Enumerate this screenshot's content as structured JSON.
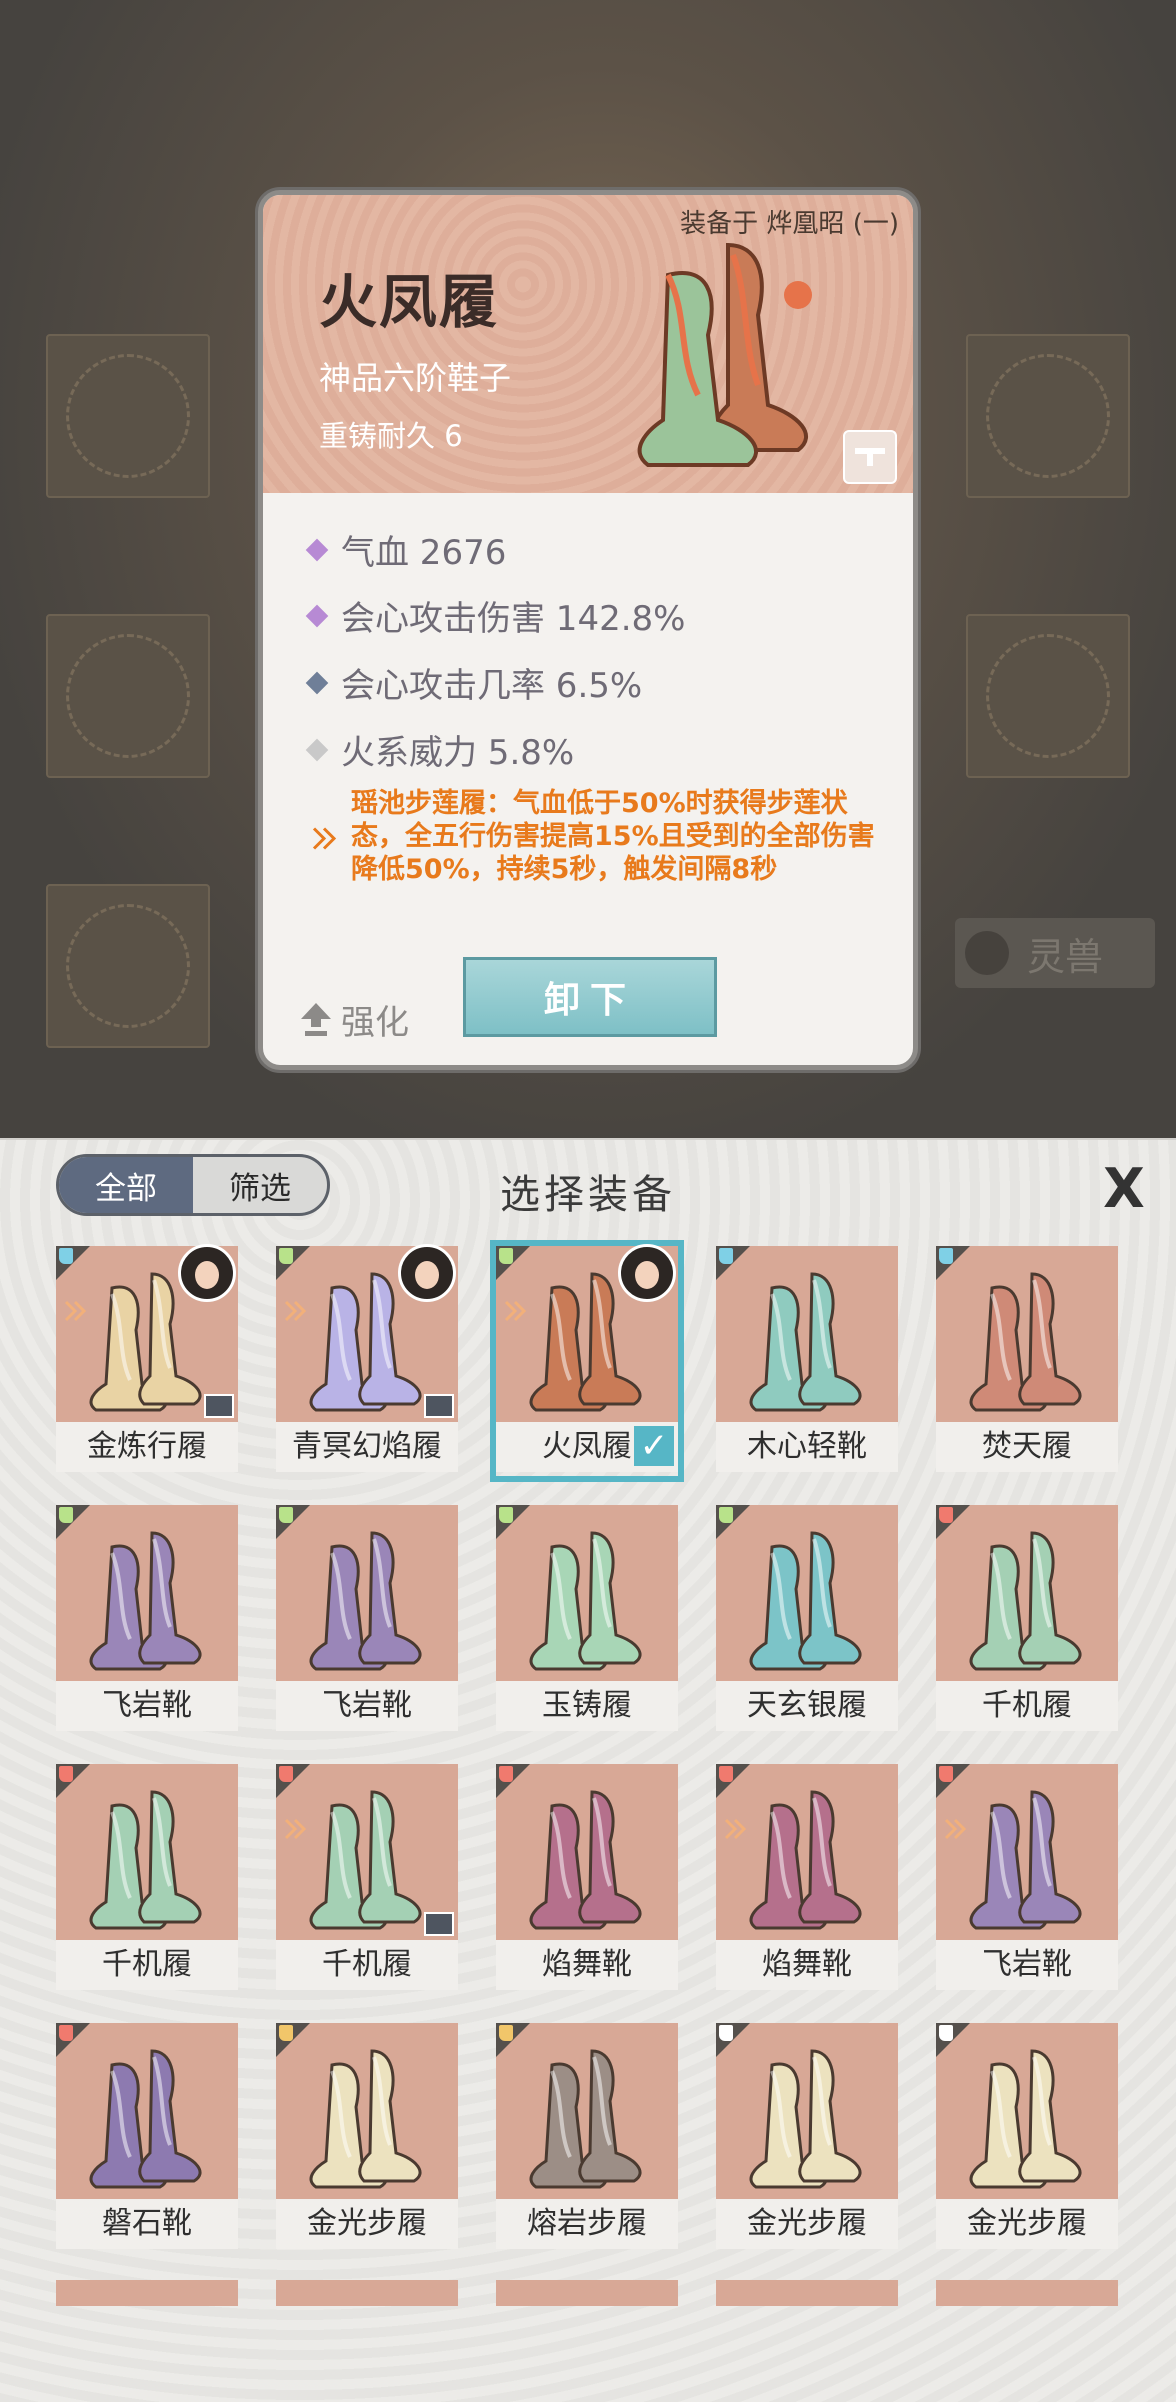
{
  "background": {
    "beast_label": "灵兽"
  },
  "detail": {
    "equipped_on": "装备于 烨凰昭 (一)",
    "name": "火凤履",
    "grade": "神品六阶鞋子",
    "durability": "重铸耐久 6",
    "stats": [
      {
        "text": "气血 2676",
        "color": "#b78ad4"
      },
      {
        "text": "会心攻击伤害 142.8%",
        "color": "#b78ad4"
      },
      {
        "text": "会心攻击几率 6.5%",
        "color": "#6f7f98"
      },
      {
        "text": "火系威力 5.8%",
        "color": "#c9c9c9"
      }
    ],
    "effect": "瑶池步莲履：气血低于50%时获得步莲状态，全五行伤害提高15%且受到的全部伤害降低50%，持续5秒，触发间隔8秒",
    "upgrade_label": "强化",
    "unequip_label": "卸下"
  },
  "panel": {
    "title": "选择装备",
    "tab_all": "全部",
    "tab_filter": "筛选",
    "close": "X"
  },
  "items": [
    {
      "name": "金炼行履",
      "tier": "blue",
      "color": "#e9d3a4",
      "bound": true,
      "tag": true,
      "avatar": true
    },
    {
      "name": "青冥幻焰履",
      "tier": "green",
      "color": "#b9b3e6",
      "bound": true,
      "tag": true,
      "avatar": true
    },
    {
      "name": "火凤履",
      "tier": "green",
      "color": "#c97b57",
      "bound": true,
      "tag": false,
      "avatar": true,
      "selected": true
    },
    {
      "name": "木心轻靴",
      "tier": "blue",
      "color": "#8fcbbf",
      "bound": false,
      "tag": false,
      "avatar": false
    },
    {
      "name": "焚天履",
      "tier": "blue",
      "color": "#cf8a77",
      "bound": false,
      "tag": false,
      "avatar": false
    },
    {
      "name": "飞岩靴",
      "tier": "green",
      "color": "#9a86b8",
      "bound": false,
      "tag": false,
      "avatar": false
    },
    {
      "name": "飞岩靴",
      "tier": "green",
      "color": "#9a86b8",
      "bound": false,
      "tag": false,
      "avatar": false
    },
    {
      "name": "玉铸履",
      "tier": "green",
      "color": "#a8d6b6",
      "bound": false,
      "tag": false,
      "avatar": false
    },
    {
      "name": "天玄银履",
      "tier": "green",
      "color": "#7cc4c8",
      "bound": false,
      "tag": false,
      "avatar": false
    },
    {
      "name": "千机履",
      "tier": "red",
      "color": "#a4d0b4",
      "bound": false,
      "tag": false,
      "avatar": false
    },
    {
      "name": "千机履",
      "tier": "red",
      "color": "#a4d0b4",
      "bound": false,
      "tag": false,
      "avatar": false
    },
    {
      "name": "千机履",
      "tier": "red",
      "color": "#a4d0b4",
      "bound": true,
      "tag": true,
      "avatar": false
    },
    {
      "name": "焰舞靴",
      "tier": "red",
      "color": "#b5708c",
      "bound": false,
      "tag": false,
      "avatar": false
    },
    {
      "name": "焰舞靴",
      "tier": "red",
      "color": "#b5708c",
      "bound": true,
      "tag": false,
      "avatar": false
    },
    {
      "name": "飞岩靴",
      "tier": "red",
      "color": "#9a86b8",
      "bound": true,
      "tag": false,
      "avatar": false
    },
    {
      "name": "磐石靴",
      "tier": "red",
      "color": "#8d7ab0",
      "bound": false,
      "tag": false,
      "avatar": false
    },
    {
      "name": "金光步履",
      "tier": "yellow",
      "color": "#ece2bf",
      "bound": false,
      "tag": false,
      "avatar": false
    },
    {
      "name": "熔岩步履",
      "tier": "yellow",
      "color": "#9c8e86",
      "bound": false,
      "tag": false,
      "avatar": false
    },
    {
      "name": "金光步履",
      "tier": "white",
      "color": "#ece2bf",
      "bound": false,
      "tag": false,
      "avatar": false
    },
    {
      "name": "金光步履",
      "tier": "white",
      "color": "#ece2bf",
      "bound": false,
      "tag": false,
      "avatar": false
    }
  ],
  "tier_colors": {
    "blue": "#7fd0e6",
    "green": "#b8e28a",
    "red": "#f07a6e",
    "yellow": "#f1c66a",
    "white": "#ffffff"
  }
}
